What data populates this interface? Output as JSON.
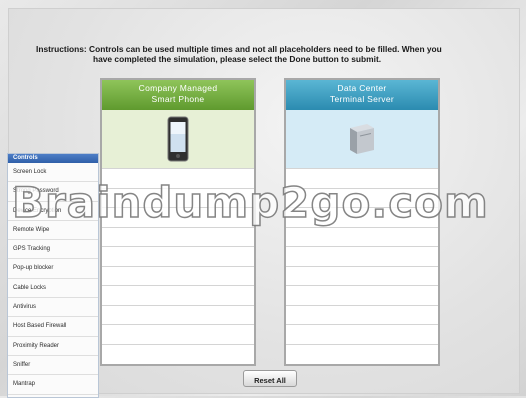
{
  "instructions": {
    "line1": "Instructions: Controls can be used multiple times and not all placeholders need to be filled. When you",
    "line2": "have completed the simulation, please select the Done button to submit."
  },
  "panels": [
    {
      "title_line1": "Company Managed",
      "title_line2": "Smart Phone",
      "device_icon": "smartphone-icon",
      "slot_count": 10
    },
    {
      "title_line1": "Data Center",
      "title_line2": "Terminal Server",
      "device_icon": "server-icon",
      "slot_count": 10
    }
  ],
  "controls": {
    "header": "Controls",
    "items": [
      "Screen Lock",
      "Strong Password",
      "Device Encryption",
      "Remote Wipe",
      "GPS Tracking",
      "Pop-up blocker",
      "Cable Locks",
      "Antivirus",
      "Host Based Firewall",
      "Proximity Reader",
      "Sniffer",
      "Mantrap"
    ]
  },
  "reset_label": "Reset All",
  "watermark": "Braindump2go.com",
  "colors": {
    "phone_header": "#6fa63b",
    "server_header": "#3a9bc0",
    "controls_header": "#3b6bb5"
  }
}
